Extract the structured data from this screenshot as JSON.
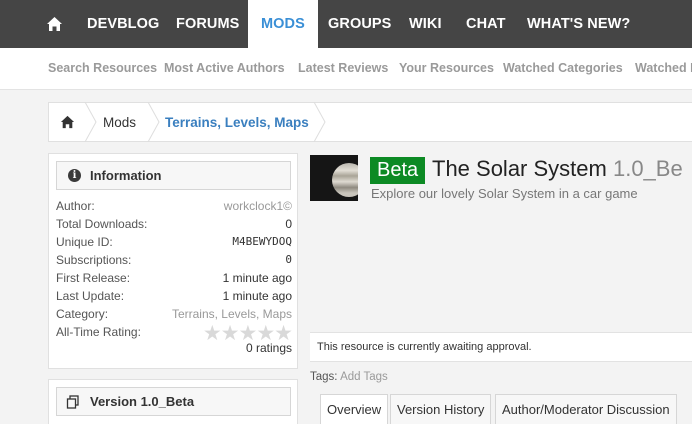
{
  "nav": {
    "items": [
      {
        "label": "DEVBLOG"
      },
      {
        "label": "FORUMS"
      },
      {
        "label": "MODS"
      },
      {
        "label": "GROUPS"
      },
      {
        "label": "WIKI"
      },
      {
        "label": "CHAT"
      },
      {
        "label": "WHAT'S NEW?"
      }
    ],
    "active": "MODS",
    "home_icon": "home-icon"
  },
  "subnav": {
    "items": [
      {
        "label": "Search Resources"
      },
      {
        "label": "Most Active Authors"
      },
      {
        "label": "Latest Reviews"
      },
      {
        "label": "Your Resources"
      },
      {
        "label": "Watched Categories"
      },
      {
        "label": "Watched R"
      }
    ]
  },
  "breadcrumb": {
    "home_icon": "home-icon",
    "items": [
      {
        "label": "Mods"
      },
      {
        "label": "Terrains, Levels, Maps"
      }
    ]
  },
  "information": {
    "title": "Information",
    "icon": "info-icon",
    "rows": {
      "author": {
        "label": "Author:",
        "value": "workclock1©"
      },
      "downloads": {
        "label": "Total Downloads:",
        "value": "0"
      },
      "unique_id": {
        "label": "Unique ID:",
        "value": "M4BEWYDOQ"
      },
      "subscriptions": {
        "label": "Subscriptions:",
        "value": "0"
      },
      "first_release": {
        "label": "First Release:",
        "value": "1 minute ago"
      },
      "last_update": {
        "label": "Last Update:",
        "value": "1 minute ago"
      },
      "category": {
        "label": "Category:",
        "value": "Terrains, Levels, Maps"
      },
      "rating": {
        "label": "All-Time Rating:",
        "stars": "★★★★★",
        "stars_filled": 0,
        "stars_total": 5,
        "count": "0 ratings"
      }
    }
  },
  "version_panel": {
    "title": "Version 1.0_Beta",
    "icon": "copy-icon"
  },
  "resource": {
    "badge": "Beta",
    "title": "The Solar System",
    "version": "1.0_Be",
    "tagline": "Explore our lovely Solar System in a car game",
    "approval_notice": "This resource is currently awaiting approval.",
    "tags_label": "Tags:",
    "tags_link": "Add Tags"
  },
  "tabs": [
    {
      "label": "Overview"
    },
    {
      "label": "Version History"
    },
    {
      "label": "Author/Moderator Discussion"
    }
  ],
  "active_tab": "Overview",
  "colors": {
    "nav_bg": "#454545",
    "accent": "#3a8fd6",
    "beta_badge": "#0c8a24"
  }
}
